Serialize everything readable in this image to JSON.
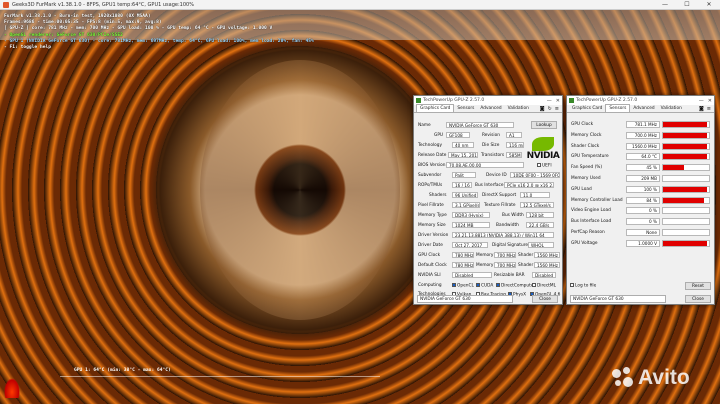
{
  "app": {
    "title": "Geeks3D FurMark v1.38.1.0 - 8FPS, GPU1 temp:64°C, GPU1 usage:100%",
    "controls": [
      "—",
      "☐",
      "✕"
    ]
  },
  "osd": [
    {
      "text": "FurMark v1.38.1.0 - Burn-in test, 1920x1080 (0X MSAA)",
      "cls": "w"
    },
    {
      "text": "Frames:9686 - time:00:05:35 - FPS:8 (min:5, max:9, avg:8)",
      "cls": "w"
    },
    {
      "text": "[ GPU-Z ] core: 781 MHz - mem: 700 MHz - GPU load: 100 % - GPU temp: 64 °C - GPU voltage: 1.000 V",
      "cls": "w"
    },
    {
      "text": "- OpenGL renderer: GeForce GT 630/PCIe/SSE2",
      "cls": "g"
    },
    {
      "text": "- GPU 1 (NVIDIA GeForce GT 630) - core: 781MHz, mem: 697MHz, temp: 64°C, GPU load: 100%, mem load: 20%, fan: 45%",
      "cls": "c"
    },
    {
      "text": "- F1: toggle help",
      "cls": "w"
    }
  ],
  "temp_readout": "GPU 1: 64°C (min: 38°C - max: 64°C)",
  "watermark": "Avito",
  "gpuz": {
    "title": "TechPowerUp GPU-Z 2.57.0",
    "tabs": [
      "Graphics Card",
      "Sensors",
      "Advanced",
      "Validation"
    ],
    "lookup": "Lookup",
    "vendor_logo": "NVIDIA",
    "rows": {
      "name": {
        "label": "Name",
        "value": "NVIDIA GeForce GT 630"
      },
      "gpu": {
        "label": "GPU",
        "value": "GF108"
      },
      "revision": {
        "label": "Revision",
        "value": "A1"
      },
      "technology": {
        "label": "Technology",
        "value": "40 nm"
      },
      "die_size": {
        "label": "Die Size",
        "value": "116 mm²"
      },
      "release_date": {
        "label": "Release Date",
        "value": "May 15, 2012"
      },
      "transistors": {
        "label": "Transistors",
        "value": "585M"
      },
      "bios": {
        "label": "BIOS Version",
        "value": "70.08.AE.00.00"
      },
      "uefi": "UEFI",
      "subvendor": {
        "label": "Subvendor",
        "value": "Palit"
      },
      "device_id": {
        "label": "Device ID",
        "value": "10DE 0F00 - 1569 0F00"
      },
      "rops": {
        "label": "ROPs/TMUs",
        "value": "16 / 16"
      },
      "bus_interface": {
        "label": "Bus Interface",
        "value": "PCIe x16 2.0 @ x16 2.0"
      },
      "shaders": {
        "label": "Shaders",
        "value": "96 Unified"
      },
      "directx": {
        "label": "DirectX Support",
        "value": "11.0"
      },
      "pixel_fill": {
        "label": "Pixel Fillrate",
        "value": "3.1 GPixel/s"
      },
      "texture_fill": {
        "label": "Texture Fillrate",
        "value": "12.5 GTexel/s"
      },
      "mem_type": {
        "label": "Memory Type",
        "value": "DDR3 (Hynix)"
      },
      "bus_width": {
        "label": "Bus Width",
        "value": "128 bit"
      },
      "mem_size": {
        "label": "Memory Size",
        "value": "1024 MB"
      },
      "bandwidth": {
        "label": "Bandwidth",
        "value": "22.4 GB/s"
      },
      "driver_version": {
        "label": "Driver Version",
        "value": "23.21.13.8813 (NVIDIA 388.13) / Win11 64"
      },
      "driver_date": {
        "label": "Driver Date",
        "value": "Oct 27, 2017"
      },
      "digital_signature": {
        "label": "Digital Signature",
        "value": "WHQL"
      },
      "gpu_clock": {
        "label": "GPU Clock",
        "value": "780 MHz",
        "mem_label": "Memory",
        "mem": "700 MHz",
        "shader_label": "Shader",
        "shader": "1560 MHz"
      },
      "default_clock": {
        "label": "Default Clock",
        "value": "780 MHz",
        "mem_label": "Memory",
        "mem": "700 MHz",
        "shader_label": "Shader",
        "shader": "1560 MHz"
      },
      "sli": {
        "label": "NVIDIA SLI",
        "value": "Disabled",
        "rebar_label": "Resizable BAR",
        "rebar": "Disabled"
      },
      "computing": {
        "label": "Computing",
        "items": [
          "OpenCL",
          "CUDA",
          "DirectCompute",
          "DirectML"
        ]
      },
      "technologies": {
        "label": "Technologies",
        "items": [
          "Vulkan",
          "Ray Tracing",
          "PhysX",
          "OpenGL 4.6"
        ]
      }
    },
    "select": "NVIDIA GeForce GT 630",
    "close": "Close"
  },
  "sensors": {
    "title": "TechPowerUp GPU-Z 2.57.0",
    "tabs": [
      "Graphics Card",
      "Sensors",
      "Advanced",
      "Validation"
    ],
    "items": [
      {
        "label": "GPU Clock",
        "value": "781.1 MHz",
        "level": 0.95
      },
      {
        "label": "Memory Clock",
        "value": "700.0 MHz",
        "level": 0.95
      },
      {
        "label": "Shader Clock",
        "value": "1560.0 MHz",
        "level": 0.95
      },
      {
        "label": "GPU Temperature",
        "value": "64.0 °C",
        "level": 0.95
      },
      {
        "label": "Fan Speed (%)",
        "value": "45 %",
        "level": 0.45
      },
      {
        "label": "Memory Used",
        "value": "209 MB",
        "level": 0.0
      },
      {
        "label": "GPU Load",
        "value": "100 %",
        "level": 0.95
      },
      {
        "label": "Memory Controller Load",
        "value": "84 %",
        "level": 0.9
      },
      {
        "label": "Video Engine Load",
        "value": "0 %",
        "level": 0
      },
      {
        "label": "Bus Interface Load",
        "value": "0 %",
        "level": 0
      },
      {
        "label": "PerfCap Reason",
        "value": "None",
        "level": 0
      },
      {
        "label": "GPU Voltage",
        "value": "1.0000 V",
        "level": 0.95
      }
    ],
    "log": "Log to file",
    "reset": "Reset",
    "select": "NVIDIA GeForce GT 630",
    "close": "Close",
    "colors": {
      "graph": "#e00000"
    }
  }
}
